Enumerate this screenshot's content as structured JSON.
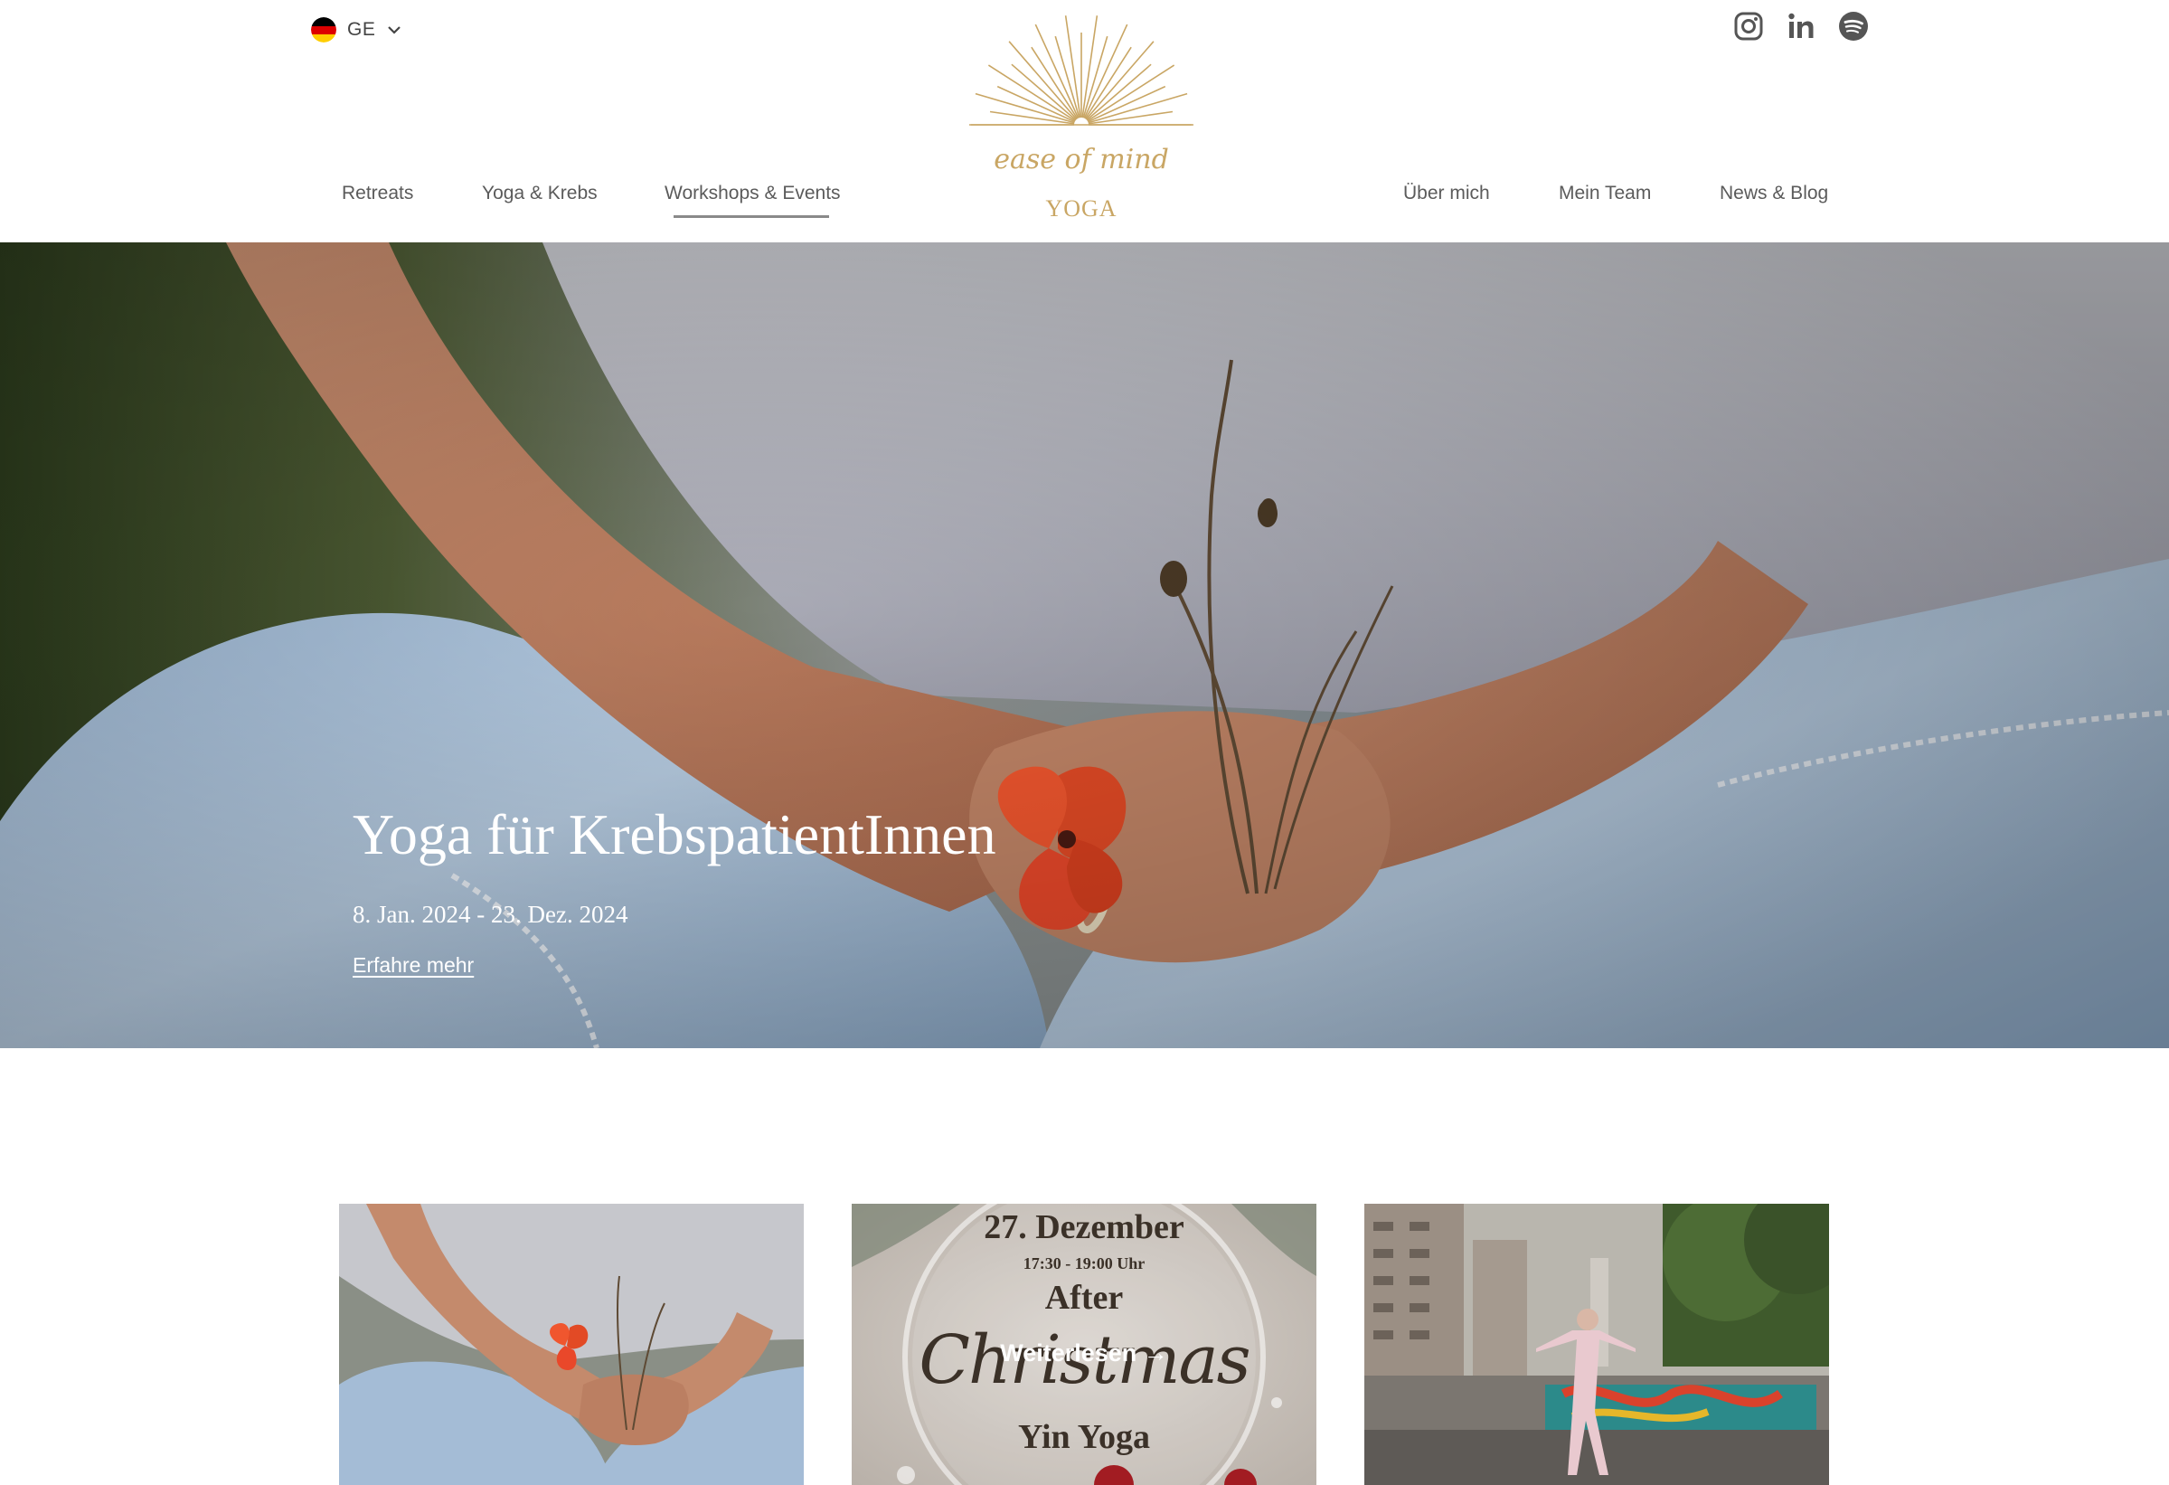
{
  "header": {
    "language": {
      "code": "GE"
    },
    "nav_left": [
      "Retreats",
      "Yoga & Krebs",
      "Workshops & Events"
    ],
    "nav_right": [
      "Über mich",
      "Mein Team",
      "News & Blog"
    ],
    "logo": {
      "script": "ease of mind",
      "word": "YOGA"
    },
    "social_icons": [
      "instagram-icon",
      "linkedin-icon",
      "spotify-icon"
    ]
  },
  "hero": {
    "title": "Yoga für KrebspatientInnen",
    "date": "8. Jan. 2024 - 23. Dez. 2024",
    "link": "Erfahre mehr"
  },
  "cards": {
    "card2": {
      "date": "27. Dezember",
      "time": "17:30 - 19:00 Uhr",
      "after": "After",
      "christmas": "Christmas",
      "yin": "Yin Yoga",
      "overlay_link": "Weiterlesen →"
    }
  },
  "colors": {
    "gold": "#c9a664",
    "text": "#5b5b5b"
  }
}
